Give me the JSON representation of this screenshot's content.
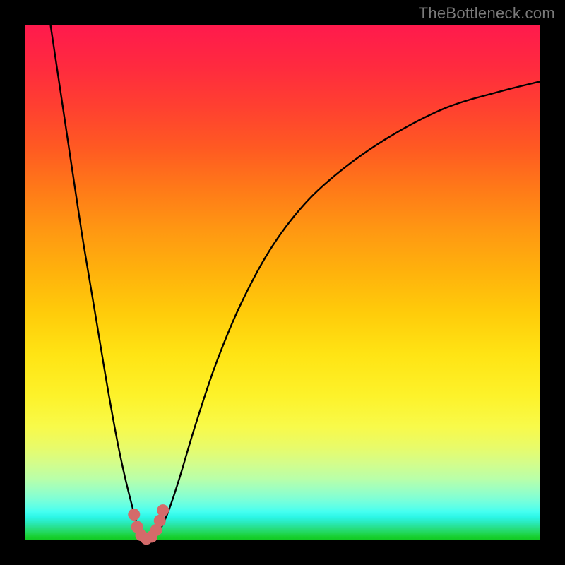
{
  "watermark": "TheBottleneck.com",
  "colors": {
    "frame": "#000000",
    "curve_stroke": "#000000",
    "marker_fill": "#d46a6a",
    "marker_stroke": "#b94e4e"
  },
  "chart_data": {
    "type": "line",
    "title": "",
    "xlabel": "",
    "ylabel": "",
    "xlim": [
      0,
      100
    ],
    "ylim": [
      0,
      100
    ],
    "grid": false,
    "series": [
      {
        "name": "bottleneck-curve",
        "x": [
          5,
          8,
          11,
          14,
          16,
          18,
          19.5,
          21,
          22,
          23,
          24,
          25.3,
          26.5,
          28,
          30,
          33,
          37,
          42,
          48,
          55,
          63,
          72,
          82,
          92,
          100
        ],
        "y": [
          100,
          80,
          60,
          42,
          30,
          19,
          12,
          6,
          2.5,
          0.8,
          0.2,
          0.8,
          2.5,
          6,
          12,
          22,
          34,
          46,
          57,
          66,
          73,
          79,
          84,
          87,
          89
        ]
      }
    ],
    "markers": {
      "name": "ideal-zone",
      "x": [
        21.2,
        21.8,
        22.6,
        23.6,
        24.6,
        25.5,
        26.2,
        26.8
      ],
      "y": [
        5.0,
        2.6,
        1.0,
        0.3,
        0.7,
        2.0,
        3.8,
        5.8
      ]
    }
  }
}
